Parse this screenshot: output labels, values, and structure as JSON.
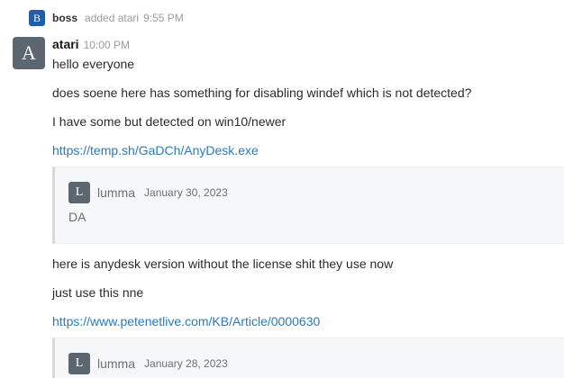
{
  "system_message": {
    "avatar_letter": "B",
    "user": "boss",
    "action": "added atari",
    "time": "9:55 PM"
  },
  "message": {
    "avatar_letter": "A",
    "author": "atari",
    "time": "10:00 PM",
    "lines": [
      "hello everyone",
      "does soene here has something for disabling windef which is not detected?",
      "I have some but detected on win10/newer"
    ],
    "link1": "https://temp.sh/GaDCh/AnyDesk.exe",
    "quote1": {
      "avatar_letter": "L",
      "author": "lumma",
      "date": "January 30, 2023",
      "text": "DA"
    },
    "lines2": [
      "here is anydesk version without the license shit they use now",
      "just use this nne"
    ],
    "link2": "https://www.petenetlive.com/KB/Article/0000630",
    "quote2": {
      "avatar_letter": "L",
      "author": "lumma",
      "date": "January 28, 2023"
    }
  },
  "colors": {
    "link": "#2a7ab8",
    "system_avatar": "#1f5fa8",
    "user_avatar": "#5c6670",
    "quote_background": "#f6f7f8"
  }
}
